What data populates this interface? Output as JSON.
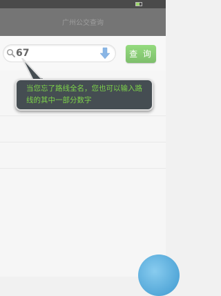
{
  "status_bar": {
    "time": ""
  },
  "title_bar": {
    "title": "广州公交查询"
  },
  "search": {
    "value": "67",
    "icon": "search-icon",
    "dropdown_icon": "dropdown-arrow-icon"
  },
  "query_button": {
    "label": "查 询",
    "color": "#4cb82d"
  },
  "history": {
    "rows": [
      {
        "label": ""
      },
      {
        "label": ""
      },
      {
        "label": ""
      }
    ]
  },
  "tooltip": {
    "text": "当您忘了路线全名，您也可以输入路线的其中一部分数字",
    "text_color": "#7dd24a",
    "background": "#454d52"
  },
  "fab": {
    "icon": "help-bubble-icon"
  }
}
